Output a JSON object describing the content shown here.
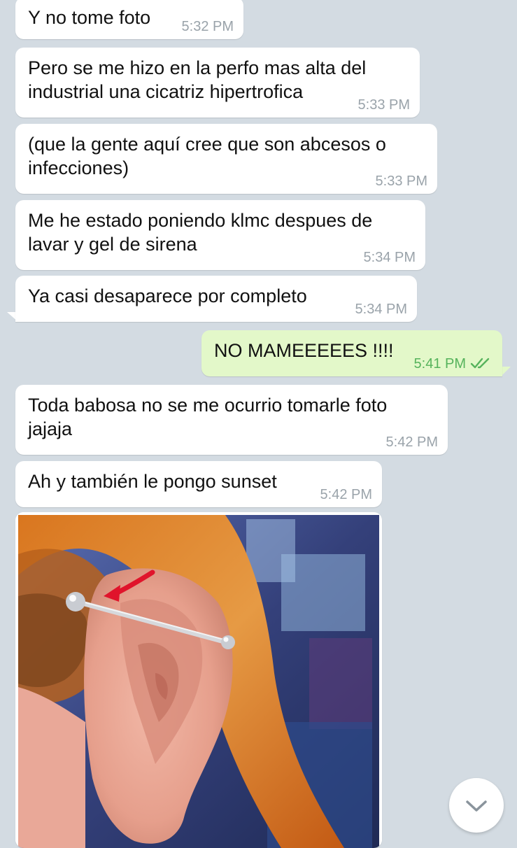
{
  "messages": [
    {
      "text": "Y no tome foto",
      "time": "5:32 PM",
      "direction": "incoming"
    },
    {
      "text": "Pero se me hizo en la perfo mas alta del industrial una cicatriz hipertrofica",
      "time": "5:33 PM",
      "direction": "incoming"
    },
    {
      "text": "(que la gente aquí cree que son abcesos o infecciones)",
      "time": "5:33 PM",
      "direction": "incoming"
    },
    {
      "text": "Me he estado poniendo klmc despues de lavar y gel de sirena",
      "time": "5:34 PM",
      "direction": "incoming"
    },
    {
      "text": "Ya casi desaparece por completo",
      "time": "5:34 PM",
      "direction": "incoming"
    },
    {
      "text": "NO MAMEEEEES !!!!",
      "time": "5:41 PM",
      "direction": "outgoing",
      "status": "read"
    },
    {
      "text": "Toda babosa no se me ocurrio tomarle foto jajaja",
      "time": "5:42 PM",
      "direction": "incoming"
    },
    {
      "text": "Ah y también le pongo sunset",
      "time": "5:42 PM",
      "direction": "incoming"
    }
  ],
  "photo_message": {
    "icon": "photo-of-ear-with-industrial-piercing"
  },
  "icons": {
    "read_receipt": "double-check-icon",
    "scroll_down": "chevron-down-icon"
  },
  "colors": {
    "chat_background": "#d3dbe2",
    "incoming_bubble": "#ffffff",
    "outgoing_bubble": "#e3f8c9",
    "incoming_time": "#9aa3aa",
    "outgoing_time": "#56b35c"
  }
}
